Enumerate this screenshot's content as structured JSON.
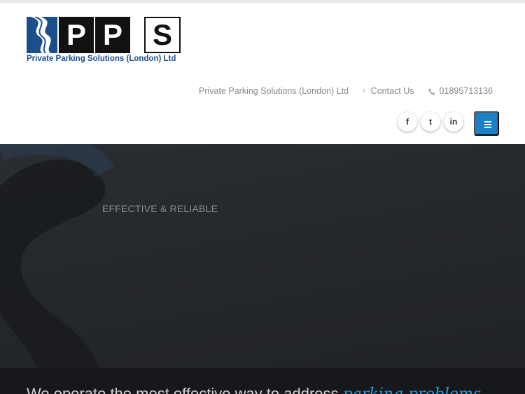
{
  "logo": {
    "letters": [
      "P",
      "P",
      "S"
    ],
    "tagline": "Private Parking Solutions (London) Ltd"
  },
  "topnav": {
    "company": "Private Parking Solutions (London) Ltd",
    "contact": "Contact Us",
    "phone": "01895713136"
  },
  "social": {
    "facebook_glyph": "f",
    "twitter_glyph": "t",
    "linkedin_glyph": "in"
  },
  "hero": {
    "tagline": "EFFECTIVE & RELIABLE",
    "headline_lead": "We operate the most effective way to address ",
    "headline_accent": "parking problems"
  },
  "colors": {
    "brand_blue": "#1b4f8c",
    "menu_button": "#1f7fc4",
    "accent_text": "#2a9ae0",
    "hero_bg": "#24272b"
  },
  "icons": [
    "road-logo-icon",
    "angle-right-icon",
    "phone-icon",
    "facebook-icon",
    "twitter-icon",
    "linkedin-icon",
    "hamburger-menu-icon"
  ]
}
